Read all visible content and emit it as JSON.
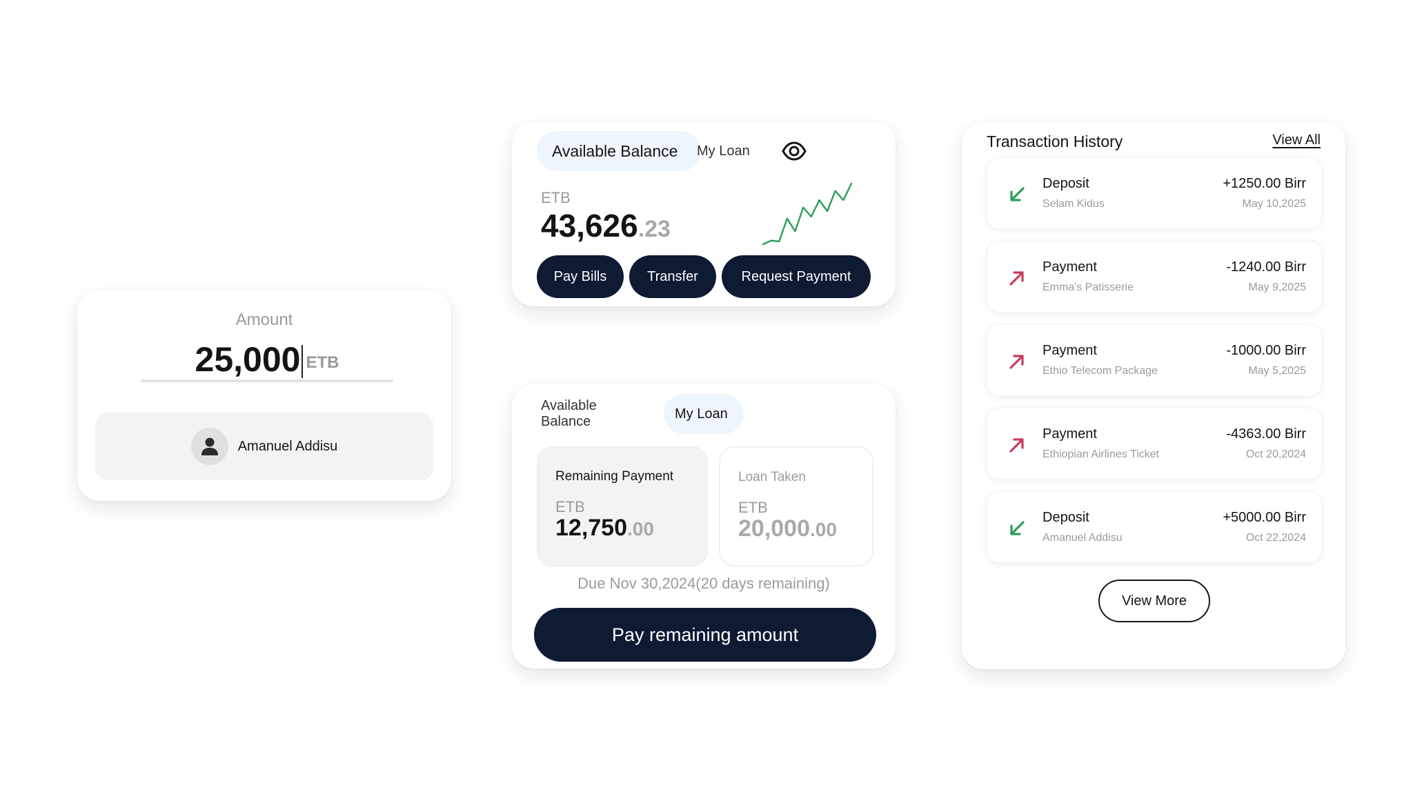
{
  "colors": {
    "dark_button": "#0f1a33",
    "active_tab": "#eef5fc",
    "muted_text": "#9a9a9a",
    "deposit_green": "#2a9d58",
    "payment_red": "#c83a5a",
    "sparkline_green": "#2a9d58"
  },
  "amount_card": {
    "label": "Amount",
    "value": "25,000",
    "currency": "ETB",
    "recipient_name": "Amanuel Addisu",
    "recipient_icon": "user-icon"
  },
  "balance_card": {
    "tab_available": "Available Balance",
    "tab_loan": "My Loan",
    "eye_icon": "eye-icon",
    "currency": "ETB",
    "amount_integer": "43,626",
    "amount_decimal": ".23",
    "buttons": {
      "pay_bills": "Pay Bills",
      "transfer": "Transfer",
      "request_payment": "Request Payment"
    },
    "sparkline_trend": [
      0,
      4,
      3,
      28,
      14,
      40,
      30,
      48,
      36,
      58,
      48,
      66
    ]
  },
  "loan_card": {
    "tab_available": "Available Balance",
    "tab_loan": "My Loan",
    "remaining": {
      "label": "Remaining Payment",
      "currency": "ETB",
      "integer": "12,750",
      "decimal": ".00"
    },
    "taken": {
      "label": "Loan Taken",
      "currency": "ETB",
      "integer": "20,000",
      "decimal": ".00"
    },
    "due_text": "Due Nov 30,2024(20 days remaining)",
    "pay_button": "Pay remaining amount"
  },
  "history": {
    "title": "Transaction History",
    "view_all": "View All",
    "view_more": "View More",
    "transactions": [
      {
        "type": "Deposit",
        "party": "Selam Kidus",
        "amount": "+1250.00 Birr",
        "date": "May 10,2025",
        "icon": "arrow-down-left-icon"
      },
      {
        "type": "Payment",
        "party": "Emma's Patisserie",
        "amount": "-1240.00 Birr",
        "date": "May 9,2025",
        "icon": "arrow-up-right-icon"
      },
      {
        "type": "Payment",
        "party": "Ethio Telecom Package",
        "amount": "-1000.00 Birr",
        "date": "May 5,2025",
        "icon": "arrow-up-right-icon"
      },
      {
        "type": "Payment",
        "party": "Ethiopian Airlines Ticket",
        "amount": "-4363.00 Birr",
        "date": "Oct 20,2024",
        "icon": "arrow-up-right-icon"
      },
      {
        "type": "Deposit",
        "party": "Amanuel Addisu",
        "amount": "+5000.00 Birr",
        "date": "Oct 22,2024",
        "icon": "arrow-down-left-icon"
      }
    ]
  }
}
